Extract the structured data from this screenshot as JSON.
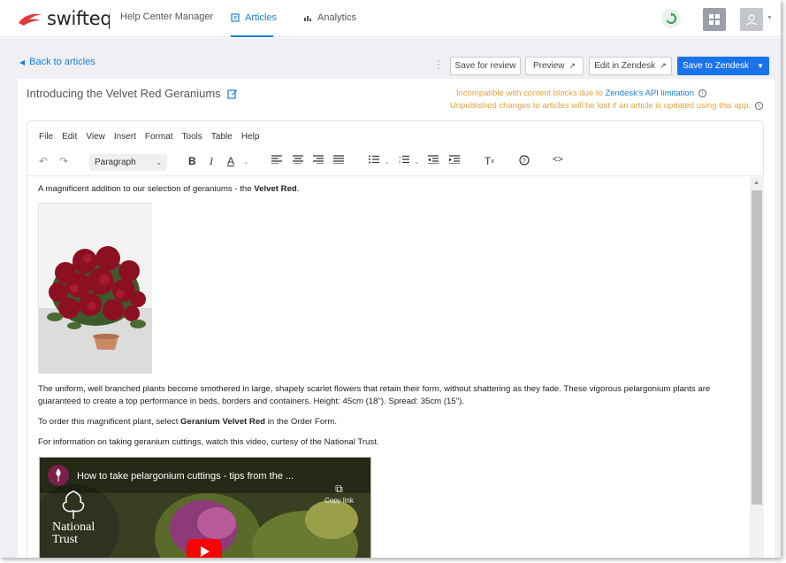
{
  "brand": {
    "name": "swifteq",
    "accent": "#e53935",
    "link_color": "#1a7ed6",
    "warning_color": "#e6a23c"
  },
  "header": {
    "app_title": "Help Center Manager",
    "tabs": [
      {
        "label": "Articles",
        "active": true
      },
      {
        "label": "Analytics",
        "active": false
      }
    ]
  },
  "actions": {
    "back": "Back to articles",
    "save_review": "Save for review",
    "preview": "Preview",
    "edit_zendesk": "Edit in Zendesk",
    "save_zendesk": "Save to Zendesk"
  },
  "article": {
    "title": "Introducing the Velvet Red Geraniums",
    "warning1_prefix": "Incompatible with content blocks due to",
    "warning1_link": "Zendesk's API limitation",
    "warning2": "Unpublished changes to articles will be lost if an article is updated using this app."
  },
  "editor": {
    "menu": [
      "File",
      "Edit",
      "View",
      "Insert",
      "Format",
      "Tools",
      "Table",
      "Help"
    ],
    "block_format": "Paragraph",
    "icons": [
      "undo-icon",
      "redo-icon",
      "bold-icon",
      "italic-icon",
      "text-color-icon",
      "align-left-icon",
      "align-center-icon",
      "align-right-icon",
      "justify-icon",
      "bullet-list-icon",
      "numbered-list-icon",
      "outdent-icon",
      "indent-icon",
      "clear-format-icon",
      "help-icon",
      "source-code-icon"
    ]
  },
  "content": {
    "p1_text": "A magnificent addition to our selection of geraniums - the ",
    "p1_bold": "Velvet Red",
    "p1_end": ".",
    "p2": "The uniform, well branched plants become smothered in large, shapely scarlet flowers that retain their form, without shattering as they fade. These vigorous pelargonium plants are guaranteed to create a top performance in beds, borders and containers. Height: 45cm (18\"). Spread: 35cm (15\").",
    "p3_text": "To order this magnificent plant, select ",
    "p3_bold": "Geranium Velvet Red",
    "p3_end": " in the Order Form.",
    "p4": "For information on taking geranium cuttings, watch this video, curtesy of the National Trust.",
    "video_title": "How to take pelargonium cuttings - tips from the ...",
    "copy_link": "Copy link",
    "video_logo_line1": "National",
    "video_logo_line2": "Trust"
  }
}
